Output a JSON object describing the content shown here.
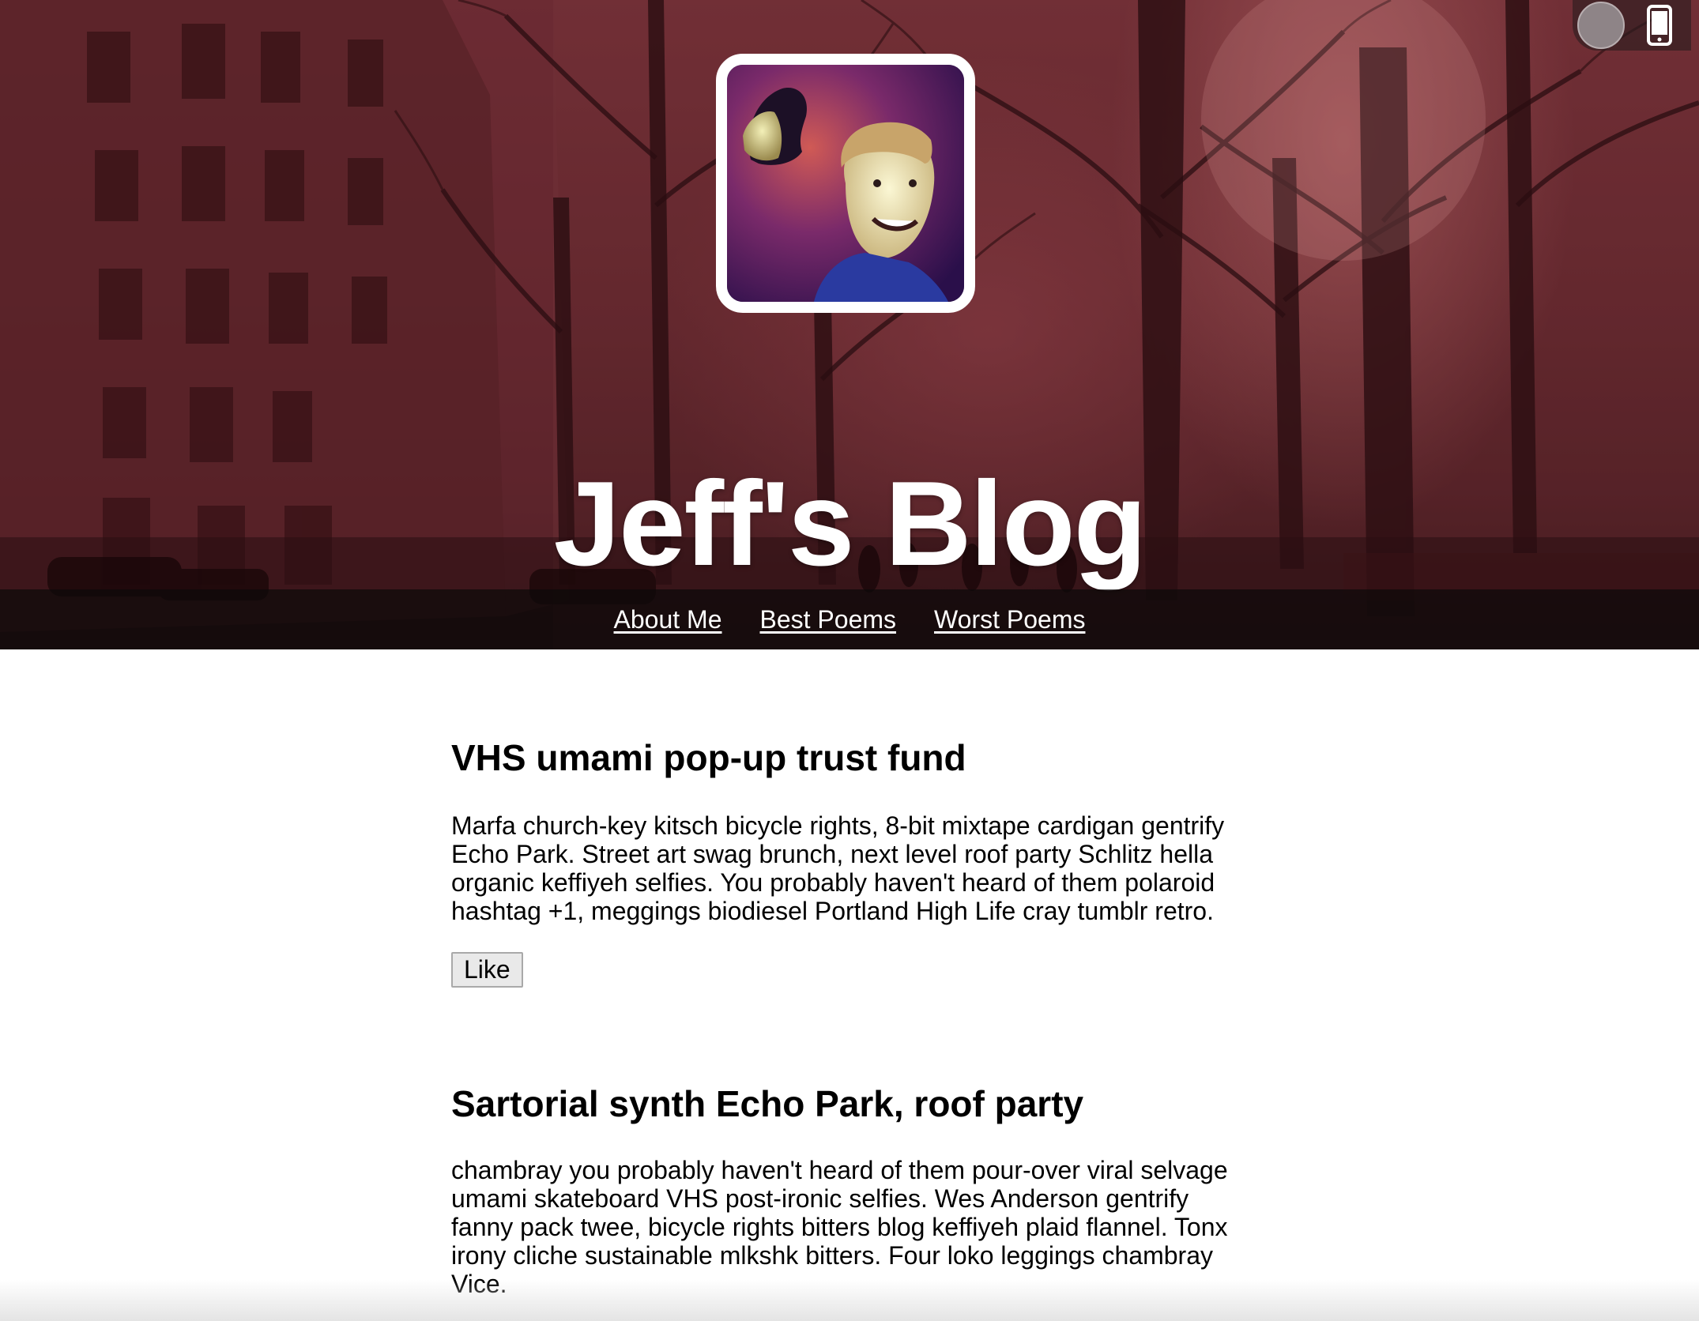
{
  "header": {
    "blog_title": "Jeff's Blog",
    "avatar_alt": "Jeff avatar",
    "nav": [
      {
        "label": "About Me"
      },
      {
        "label": "Best Poems"
      },
      {
        "label": "Worst Poems"
      }
    ],
    "device_toggle": {
      "knob": "toggle-knob",
      "icon": "mobile-phone-icon"
    }
  },
  "posts": [
    {
      "title": "VHS umami pop-up trust fund",
      "body": "Marfa church-key kitsch bicycle rights, 8-bit mixtape cardigan gentrify Echo Park. Street art swag brunch, next level roof party Schlitz hella organic keffiyeh selfies. You probably haven't heard of them polaroid hashtag +1, meggings biodiesel Portland High Life cray tumblr retro.",
      "like_label": "Like"
    },
    {
      "title": "Sartorial synth Echo Park, roof party",
      "body": "chambray you probably haven't heard of them pour-over viral selvage umami skateboard VHS post-ironic selfies. Wes Anderson gentrify fanny pack twee, bicycle rights bitters blog keffiyeh plaid flannel. Tonx irony cliche sustainable mlkshk bitters. Four loko leggings chambray Vice."
    }
  ],
  "colors": {
    "hero_tint": "#5d2229",
    "nav_bar": "#0c0a0a",
    "title_text": "#ffffff",
    "body_text": "#000000"
  }
}
